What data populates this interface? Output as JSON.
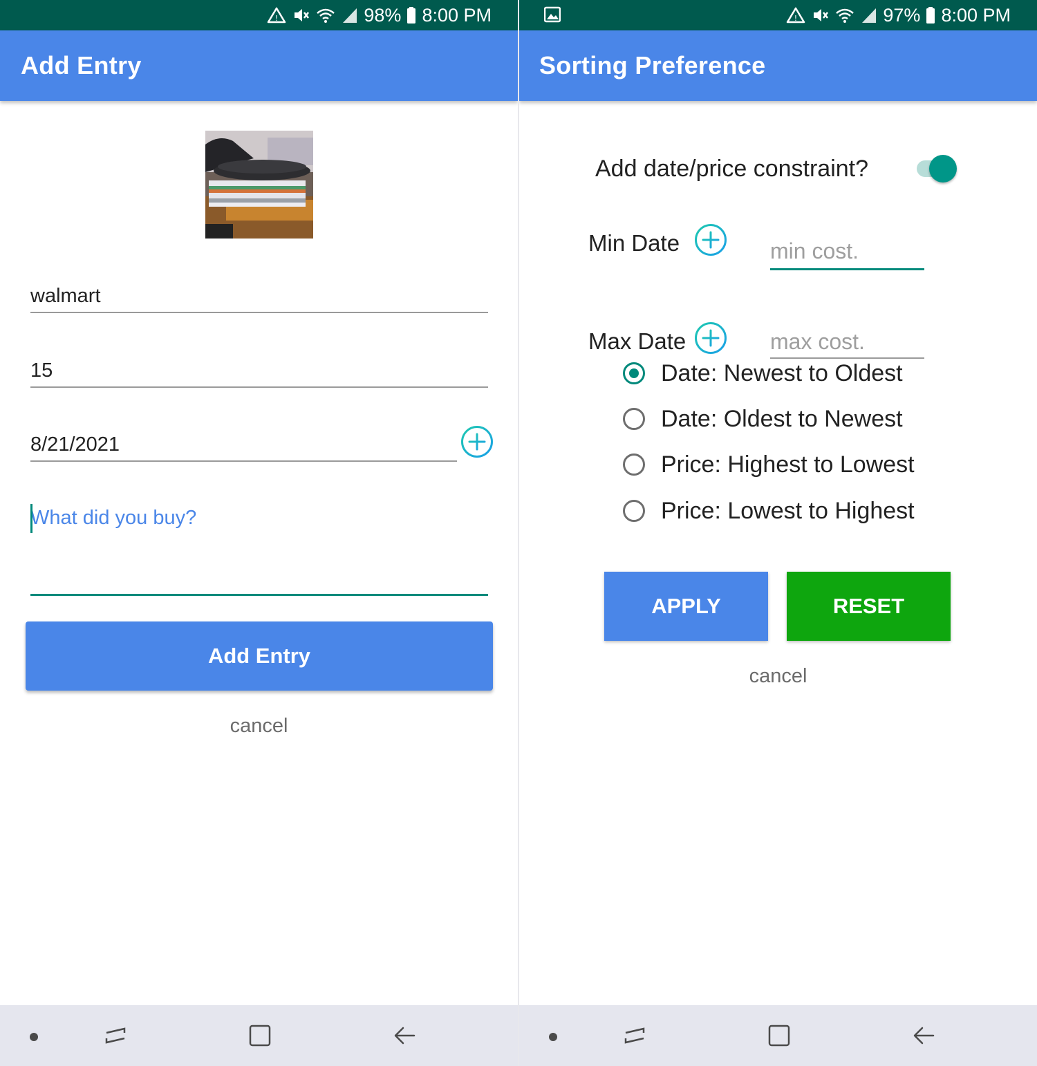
{
  "left_screen": {
    "status": {
      "battery": "98%",
      "time": "8:00 PM"
    },
    "app_title": "Add Entry",
    "store_value": "walmart",
    "amount_value": "15",
    "date_value": "8/21/2021",
    "description_placeholder": "What did you buy?",
    "add_button_label": "Add Entry",
    "cancel_label": "cancel"
  },
  "right_screen": {
    "status": {
      "battery": "97%",
      "time": "8:00 PM"
    },
    "app_title": "Sorting Preference",
    "toggle_label": "Add date/price constraint?",
    "toggle_on": true,
    "min_date_label": "Min Date",
    "max_date_label": "Max Date",
    "min_cost_placeholder": "min cost.",
    "max_cost_placeholder": "max cost.",
    "sort_options": [
      {
        "label": "Date: Newest to Oldest",
        "selected": true
      },
      {
        "label": "Date: Oldest to Newest",
        "selected": false
      },
      {
        "label": "Price: Highest to Lowest",
        "selected": false
      },
      {
        "label": "Price: Lowest to Highest",
        "selected": false
      }
    ],
    "apply_label": "APPLY",
    "reset_label": "RESET",
    "cancel_label": "cancel"
  },
  "colors": {
    "status_bar": "#005a4e",
    "app_bar": "#4a86e8",
    "accent": "#00897b",
    "reset_green": "#0ea60e",
    "nav_bar": "#e5e6ee"
  },
  "icons": [
    "alert-icon",
    "mute-icon",
    "wifi-icon",
    "signal-icon",
    "battery-icon",
    "gallery-icon",
    "add-circle-icon",
    "recents-icon",
    "home-icon",
    "back-icon"
  ]
}
